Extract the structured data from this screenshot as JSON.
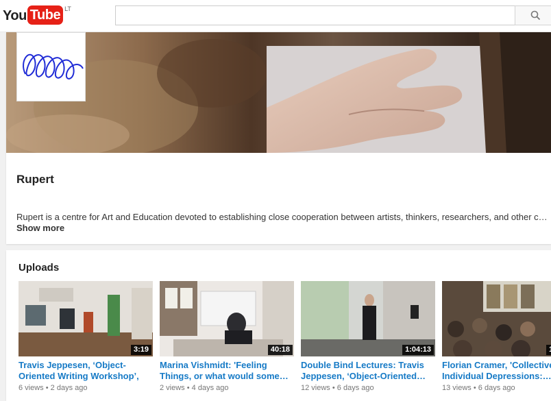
{
  "header": {
    "logo_you": "You",
    "logo_tube": "Tube",
    "logo_country": "LT",
    "search_placeholder": ""
  },
  "channel": {
    "name": "Rupert",
    "description": "Rupert is a centre for Art and Education devoted to establishing close cooperation between artists, thinkers, researchers, and other cultural practitioners.",
    "show_more": "Show more"
  },
  "uploads": {
    "title": "Uploads",
    "videos": [
      {
        "title": "Travis Jeppesen, ‘Object-Oriented Writing Workshop’, Kazys…",
        "duration": "3:19",
        "views": "6 views",
        "age": "2 days ago"
      },
      {
        "title": "Marina Vishmidt: 'Feeling Things, or what would some…",
        "duration": "40:18",
        "views": "2 views",
        "age": "4 days ago"
      },
      {
        "title": "Double Bind Lectures: Travis Jeppesen, ‘Object-Oriented…",
        "duration": "1:04:13",
        "views": "12 views",
        "age": "6 days ago"
      },
      {
        "title": "Florian Cramer, 'Collective-Individual Depressions:…",
        "duration": "1",
        "views": "13 views",
        "age": "6 days ago"
      }
    ],
    "separator": "•"
  },
  "colors": {
    "brand_red": "#e62117",
    "link_blue": "#167ac6",
    "meta_gray": "#767676",
    "page_bg": "#f1f1f1"
  },
  "icons": [
    "search-icon"
  ]
}
